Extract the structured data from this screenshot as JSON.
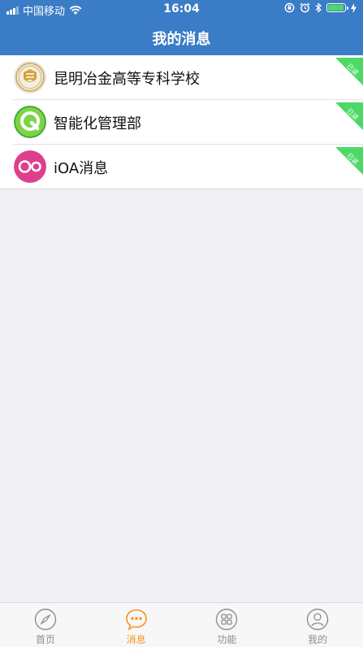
{
  "status_bar": {
    "carrier": "中国移动",
    "time": "16:04"
  },
  "header": {
    "title": "我的消息"
  },
  "messages": [
    {
      "title": "昆明冶金高等专科学校",
      "badge": "已读",
      "icon": "school-emblem-icon"
    },
    {
      "title": "智能化管理部",
      "badge": "已读",
      "icon": "green-q-logo-icon"
    },
    {
      "title": "iOA消息",
      "badge": "已读",
      "icon": "pink-double-circle-icon"
    }
  ],
  "tabbar": {
    "tabs": [
      {
        "label": "首页",
        "icon": "compass-icon",
        "active": false
      },
      {
        "label": "消息",
        "icon": "chat-bubble-icon",
        "active": true
      },
      {
        "label": "功能",
        "icon": "grid-icon",
        "active": false
      },
      {
        "label": "我的",
        "icon": "user-icon",
        "active": false
      }
    ]
  },
  "colors": {
    "primary": "#3a7cc5",
    "ribbon": "#4cd964",
    "tab_active": "#f7931e",
    "tab_inactive": "#8e8e93",
    "background": "#efeff4"
  }
}
